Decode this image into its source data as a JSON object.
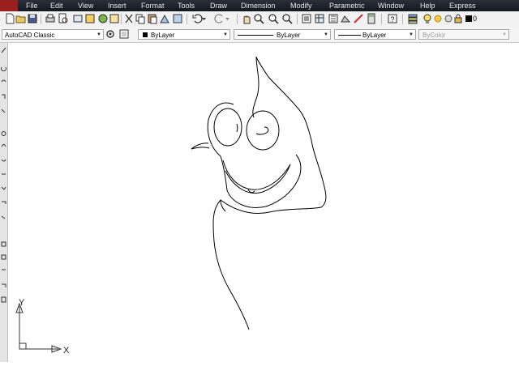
{
  "menu": [
    "File",
    "Edit",
    "View",
    "Insert",
    "Format",
    "Tools",
    "Draw",
    "Dimension",
    "Modify",
    "Parametric",
    "Window",
    "Help",
    "Express"
  ],
  "toolbar": {
    "current_layer": "0",
    "icons": [
      "new-icon",
      "open-icon",
      "save-icon",
      "plot-icon",
      "plot-preview-icon",
      "publish-icon",
      "3d-dwf-icon",
      "etransmit-icon",
      "cut-icon",
      "copy-icon",
      "paste-icon",
      "match-properties-icon",
      "block-editor-icon",
      "undo-icon",
      "redo-icon",
      "pan-icon",
      "zoom-realtime-icon",
      "zoom-window-icon",
      "zoom-previous-icon",
      "properties-icon",
      "design-center-icon",
      "tool-palettes-icon",
      "sheet-set-icon",
      "markup-icon",
      "calculator-icon",
      "help-icon",
      "layer-properties-icon",
      "layer-state-icons"
    ]
  },
  "workspace": {
    "value": "AutoCAD Classic"
  },
  "properties": {
    "color": "ByLayer",
    "linetype": "ByLayer",
    "lineweight": "ByLayer",
    "plotstyle": "ByColor"
  },
  "ucs": {
    "y_label": "Y",
    "x_label": "X"
  },
  "colors": {
    "menubar": "#1c2028",
    "toolbar": "#f2f2f2",
    "canvas": "#ffffff",
    "drawing_stroke": "#000000",
    "app_badge": "#9a1f1f"
  }
}
